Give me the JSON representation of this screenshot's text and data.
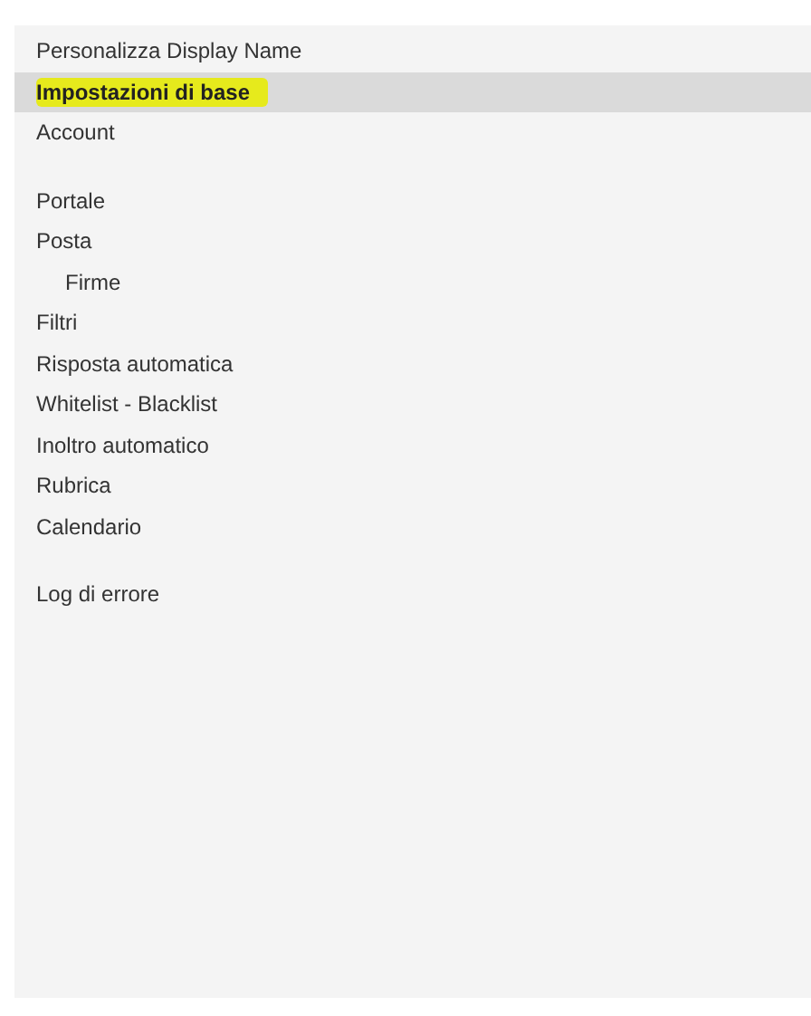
{
  "sidebar": {
    "groups": [
      {
        "items": [
          {
            "label": "Personalizza Display Name",
            "selected": false,
            "highlighted": false
          },
          {
            "label": "Impostazioni di base",
            "selected": true,
            "highlighted": true
          },
          {
            "label": "Account",
            "selected": false,
            "highlighted": false
          }
        ]
      },
      {
        "items": [
          {
            "label": "Portale",
            "selected": false,
            "highlighted": false
          },
          {
            "label": "Posta",
            "selected": false,
            "highlighted": false,
            "children": [
              {
                "label": "Firme",
                "selected": false,
                "highlighted": false
              }
            ]
          },
          {
            "label": "Filtri",
            "selected": false,
            "highlighted": false
          },
          {
            "label": "Risposta automatica",
            "selected": false,
            "highlighted": false
          },
          {
            "label": "Whitelist - Blacklist",
            "selected": false,
            "highlighted": false
          },
          {
            "label": "Inoltro automatico",
            "selected": false,
            "highlighted": false
          },
          {
            "label": "Rubrica",
            "selected": false,
            "highlighted": false
          },
          {
            "label": "Calendario",
            "selected": false,
            "highlighted": false
          }
        ]
      },
      {
        "items": [
          {
            "label": "Log di errore",
            "selected": false,
            "highlighted": false
          }
        ]
      }
    ]
  }
}
